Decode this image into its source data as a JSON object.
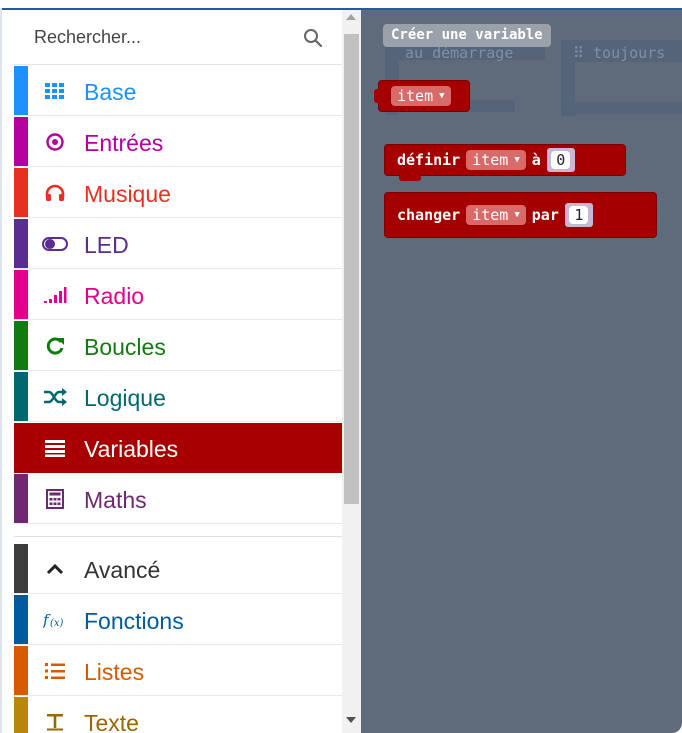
{
  "search": {
    "placeholder": "Rechercher..."
  },
  "colors": {
    "base": "#1e90ff",
    "entrees": "#b4009e",
    "musique": "#e63022",
    "led": "#5c2d91",
    "radio": "#e3008c",
    "boucles": "#107c10",
    "logique": "#006970",
    "variables": "#a80000",
    "maths": "#712672",
    "avance": "#3c3c3c",
    "fonctions": "#005a9e",
    "listes": "#d65a00",
    "texte": "#b8860b",
    "workspace": "#5f6a7a"
  },
  "categories": [
    {
      "label": "Base",
      "icon": "grid-icon"
    },
    {
      "label": "Entrées",
      "icon": "target-icon"
    },
    {
      "label": "Musique",
      "icon": "headphones-icon"
    },
    {
      "label": "LED",
      "icon": "toggle-icon"
    },
    {
      "label": "Radio",
      "icon": "signal-bars-icon"
    },
    {
      "label": "Boucles",
      "icon": "refresh-icon"
    },
    {
      "label": "Logique",
      "icon": "shuffle-icon"
    },
    {
      "label": "Variables",
      "icon": "lines-icon",
      "selected": true
    },
    {
      "label": "Maths",
      "icon": "calculator-icon"
    }
  ],
  "advanced": [
    {
      "label": "Avancé",
      "icon": "chevron-up-icon"
    },
    {
      "label": "Fonctions",
      "icon": "function-icon"
    },
    {
      "label": "Listes",
      "icon": "list-icon"
    },
    {
      "label": "Texte",
      "icon": "text-icon"
    }
  ],
  "workspace": {
    "create_variable": "Créer une variable",
    "ghost_on_start": "au démarrage",
    "ghost_forever": "toujours",
    "var_block": {
      "variable": "item"
    },
    "set_block": {
      "label": "définir",
      "variable": "item",
      "to": "à",
      "value": "0"
    },
    "change_block": {
      "label": "changer",
      "variable": "item",
      "by": "par",
      "value": "1"
    }
  }
}
